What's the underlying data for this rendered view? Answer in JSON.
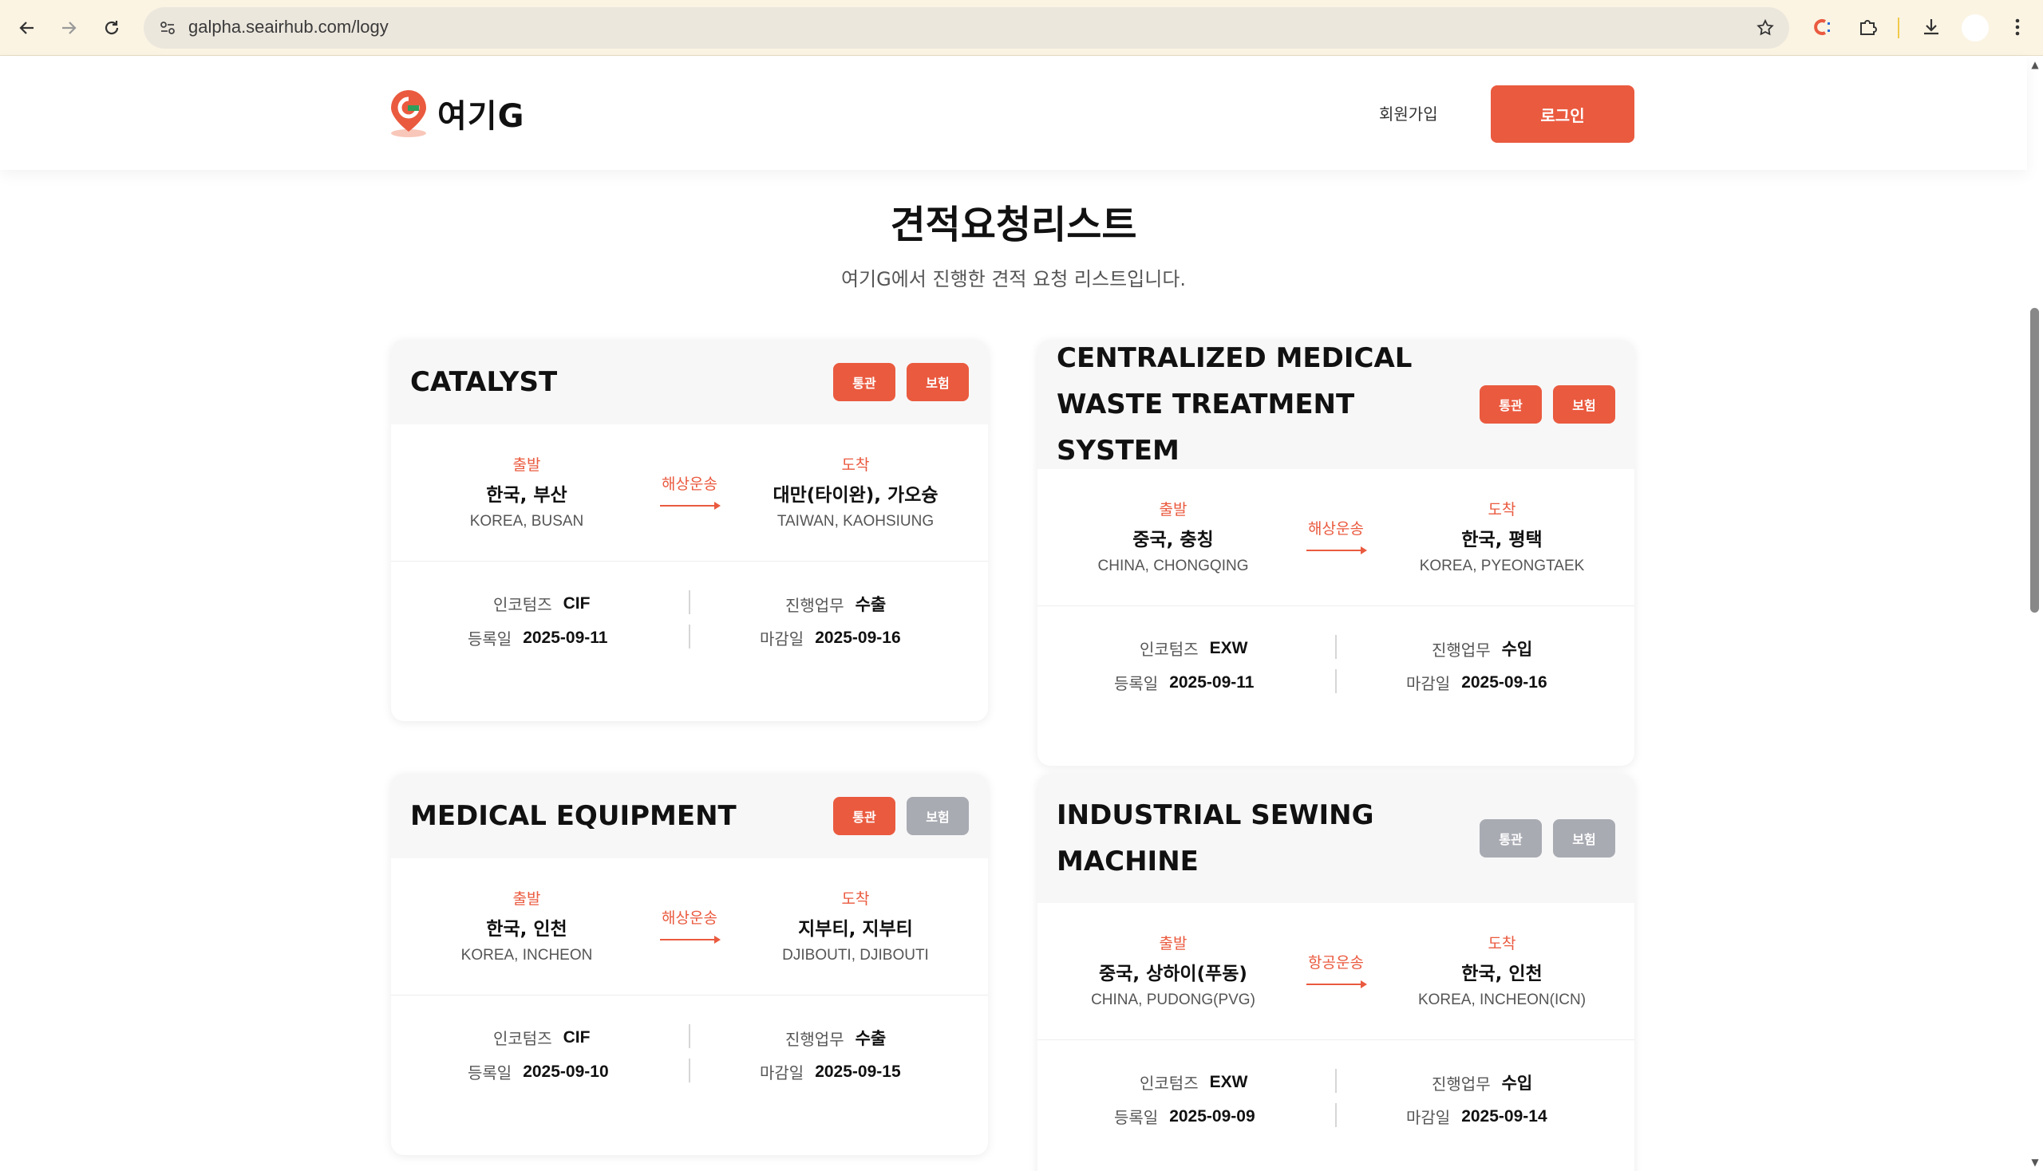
{
  "browser": {
    "url": "galpha.seairhub.com/logy"
  },
  "header": {
    "logo_text": "여기G",
    "signup_label": "회원가입",
    "login_label": "로그인",
    "accent_color": "#ea5a3f"
  },
  "page": {
    "title": "견적요청리스트",
    "subtitle": "여기G에서 진행한 견적 요청 리스트입니다."
  },
  "labels": {
    "origin": "출발",
    "destination": "도착",
    "incoterms": "인코텀즈",
    "task": "진행업무",
    "registered": "등록일",
    "deadline": "마감일",
    "customs_badge": "통관",
    "insurance_badge": "보험"
  },
  "cards": [
    {
      "title": "CATALYST",
      "customs": true,
      "insurance": true,
      "origin_kor": "한국, 부산",
      "origin_eng": "KOREA, BUSAN",
      "mode": "해상운송",
      "dest_kor": "대만(타이완), 가오슝",
      "dest_eng": "TAIWAN, KAOHSIUNG",
      "incoterms": "CIF",
      "task": "수출",
      "registered": "2025-09-11",
      "deadline": "2025-09-16"
    },
    {
      "title": "CENTRALIZED MEDICAL WASTE TREATMENT SYSTEM",
      "customs": true,
      "insurance": true,
      "origin_kor": "중국, 충칭",
      "origin_eng": "CHINA, CHONGQING",
      "mode": "해상운송",
      "dest_kor": "한국, 평택",
      "dest_eng": "KOREA, PYEONGTAEK",
      "incoterms": "EXW",
      "task": "수입",
      "registered": "2025-09-11",
      "deadline": "2025-09-16"
    },
    {
      "title": "MEDICAL EQUIPMENT",
      "customs": true,
      "insurance": false,
      "origin_kor": "한국, 인천",
      "origin_eng": "KOREA, INCHEON",
      "mode": "해상운송",
      "dest_kor": "지부티, 지부티",
      "dest_eng": "DJIBOUTI, DJIBOUTI",
      "incoterms": "CIF",
      "task": "수출",
      "registered": "2025-09-10",
      "deadline": "2025-09-15"
    },
    {
      "title": "INDUSTRIAL SEWING MACHINE",
      "customs": false,
      "insurance": false,
      "origin_kor": "중국, 상하이(푸동)",
      "origin_eng": "CHINA, PUDONG(PVG)",
      "mode": "항공운송",
      "dest_kor": "한국, 인천",
      "dest_eng": "KOREA, INCHEON(ICN)",
      "incoterms": "EXW",
      "task": "수입",
      "registered": "2025-09-09",
      "deadline": "2025-09-14"
    }
  ]
}
